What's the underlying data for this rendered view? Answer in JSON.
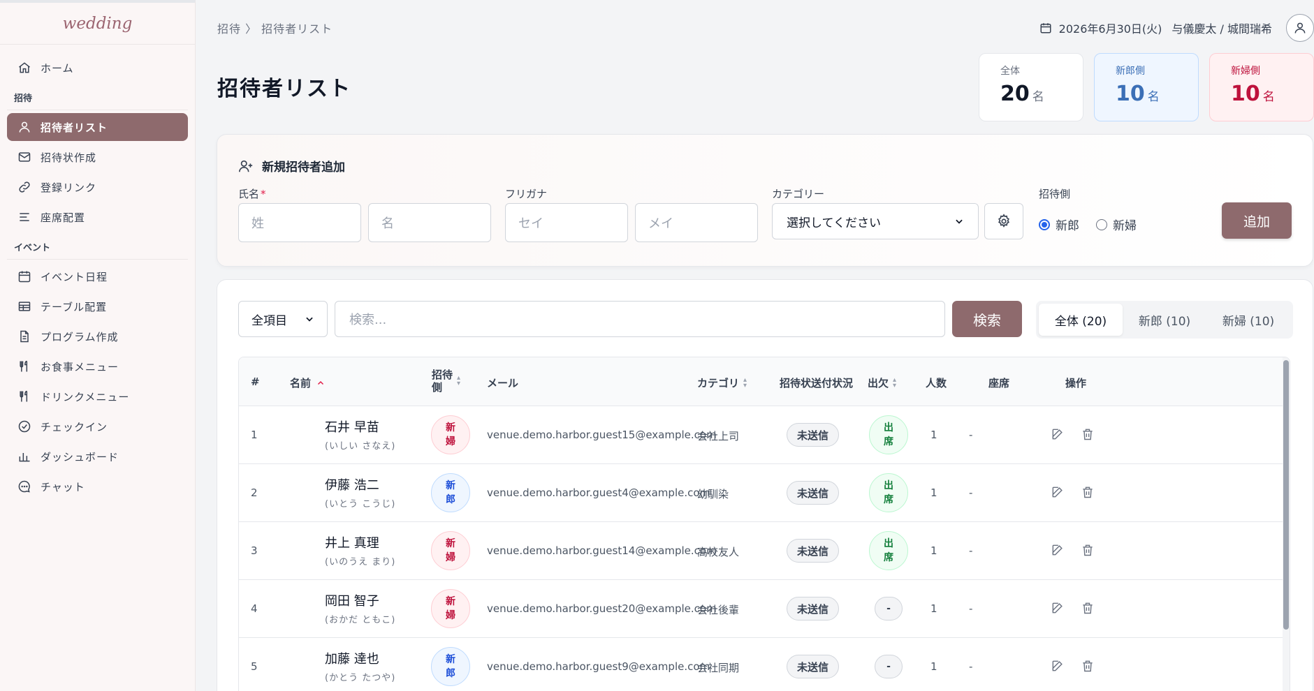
{
  "brand": "wedding",
  "sidebar": {
    "home": "ホーム",
    "section_invite": "招待",
    "items_invite": [
      {
        "label": "招待者リスト"
      },
      {
        "label": "招待状作成"
      },
      {
        "label": "登録リンク"
      },
      {
        "label": "座席配置"
      }
    ],
    "section_event": "イベント",
    "items_event": [
      {
        "label": "イベント日程"
      },
      {
        "label": "テーブル配置"
      },
      {
        "label": "プログラム作成"
      },
      {
        "label": "お食事メニュー"
      },
      {
        "label": "ドリンクメニュー"
      },
      {
        "label": "チェックイン"
      },
      {
        "label": "ダッシュボード"
      },
      {
        "label": "チャット"
      }
    ]
  },
  "header": {
    "breadcrumb": "招待 〉 招待者リスト",
    "date": "2026年6月30日(火)",
    "couple": "与儀慶太 / 城間瑞希",
    "page_title": "招待者リスト"
  },
  "stats": {
    "total": {
      "label": "全体",
      "value": "20",
      "unit": "名"
    },
    "groom": {
      "label": "新郎側",
      "value": "10",
      "unit": "名"
    },
    "bride": {
      "label": "新婦側",
      "value": "10",
      "unit": "名"
    }
  },
  "add_form": {
    "title": "新規招待者追加",
    "name_label": "氏名",
    "required_mark": "*",
    "last_name_placeholder": "姓",
    "first_name_placeholder": "名",
    "kana_label": "フリガナ",
    "kana_last_placeholder": "セイ",
    "kana_first_placeholder": "メイ",
    "category_label": "カテゴリー",
    "category_value": "選択してください",
    "side_label": "招待側",
    "side_groom": "新郎",
    "side_bride": "新婦",
    "add_button": "追加"
  },
  "list": {
    "filter_value": "全項目",
    "search_placeholder": "検索...",
    "search_button": "検索",
    "tabs": [
      {
        "label": "全体 (20)"
      },
      {
        "label": "新郎 (10)"
      },
      {
        "label": "新婦 (10)"
      }
    ],
    "columns": {
      "num": "#",
      "name": "名前",
      "side_line1": "招待",
      "side_line2": "側",
      "email": "メール",
      "category": "カテゴリ",
      "sent": "招待状送付状況",
      "attendance": "出欠",
      "count": "人数",
      "seat": "座席",
      "ops": "操作"
    },
    "rows": [
      {
        "num": "1",
        "name": "石井 早苗",
        "kana": "(いしい さなえ)",
        "side": "bride",
        "side_l1": "新",
        "side_l2": "婦",
        "email": "venue.demo.harbor.guest15@example.com",
        "category": "会社上司",
        "sent": "未送信",
        "att": "yes",
        "att_l1": "出",
        "att_l2": "席",
        "count": "1",
        "seat": "-"
      },
      {
        "num": "2",
        "name": "伊藤 浩二",
        "kana": "(いとう こうじ)",
        "side": "groom",
        "side_l1": "新",
        "side_l2": "郎",
        "email": "venue.demo.harbor.guest4@example.com",
        "category": "幼馴染",
        "sent": "未送信",
        "att": "yes",
        "att_l1": "出",
        "att_l2": "席",
        "count": "1",
        "seat": "-"
      },
      {
        "num": "3",
        "name": "井上 真理",
        "kana": "(いのうえ まり)",
        "side": "bride",
        "side_l1": "新",
        "side_l2": "婦",
        "email": "venue.demo.harbor.guest14@example.com",
        "category": "高校友人",
        "sent": "未送信",
        "att": "yes",
        "att_l1": "出",
        "att_l2": "席",
        "count": "1",
        "seat": "-"
      },
      {
        "num": "4",
        "name": "岡田 智子",
        "kana": "(おかだ ともこ)",
        "side": "bride",
        "side_l1": "新",
        "side_l2": "婦",
        "email": "venue.demo.harbor.guest20@example.com",
        "category": "会社後輩",
        "sent": "未送信",
        "att": "none",
        "att_l1": "-",
        "att_l2": "",
        "count": "1",
        "seat": "-"
      },
      {
        "num": "5",
        "name": "加藤 達也",
        "kana": "(かとう たつや)",
        "side": "groom",
        "side_l1": "新",
        "side_l2": "郎",
        "email": "venue.demo.harbor.guest9@example.com",
        "category": "会社同期",
        "sent": "未送信",
        "att": "none",
        "att_l1": "-",
        "att_l2": "",
        "count": "1",
        "seat": "-"
      }
    ]
  },
  "colors": {
    "accent": "#8e6a6d",
    "groom": "#3b6fb6",
    "bride": "#be123c",
    "attend": "#15803d"
  }
}
